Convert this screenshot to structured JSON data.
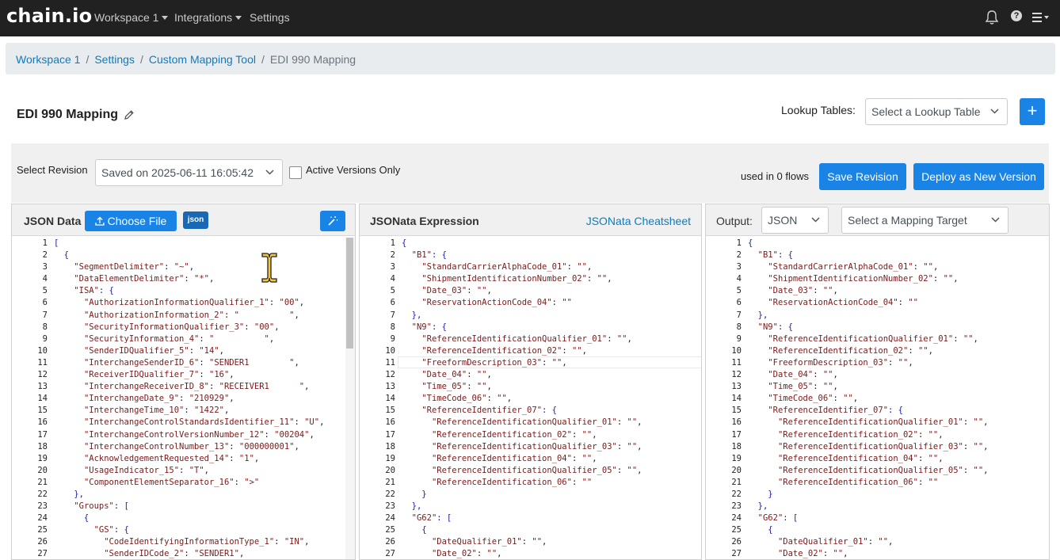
{
  "app": {
    "logo": "chain.io"
  },
  "topnav": {
    "workspace": "Workspace 1",
    "integrations": "Integrations",
    "settings": "Settings"
  },
  "breadcrumb": [
    "Workspace 1",
    "Settings",
    "Custom Mapping Tool",
    "EDI 990 Mapping"
  ],
  "page": {
    "title": "EDI 990 Mapping",
    "lookup_label": "Lookup Tables:",
    "lookup_placeholder": "Select a Lookup Table"
  },
  "revision": {
    "label": "Select Revision",
    "selected": "Saved on 2025-06-11 16:05:42",
    "active_only_label": "Active Versions Only",
    "flows_text": "used in 0 flows",
    "save_button": "Save Revision",
    "deploy_button": "Deploy as New Version"
  },
  "json_panel": {
    "title": "JSON Data",
    "choose_file": "Choose File",
    "badge": "json",
    "lines": [
      "[",
      "  {",
      "    \"SegmentDelimiter\": \"~\",",
      "    \"DataElementDelimiter\": \"*\",",
      "    \"ISA\": {",
      "      \"AuthorizationInformationQualifier_1\": \"00\",",
      "      \"AuthorizationInformation_2\": \"          \",",
      "      \"SecurityInformationQualifier_3\": \"00\",",
      "      \"SecurityInformation_4\": \"          \",",
      "      \"SenderIDQualifier_5\": \"14\",",
      "      \"InterchangeSenderID_6\": \"SENDER1        \",",
      "      \"ReceiverIDQualifier_7\": \"16\",",
      "      \"InterchangeReceiverID_8\": \"RECEIVER1      \",",
      "      \"InterchangeDate_9\": \"210929\",",
      "      \"InterchangeTime_10\": \"1422\",",
      "      \"InterchangeControlStandardsIdentifier_11\": \"U\",",
      "      \"InterchangeControlVersionNumber_12\": \"00204\",",
      "      \"InterchangeControlNumber_13\": \"000000001\",",
      "      \"AcknowledgementRequested_14\": \"1\",",
      "      \"UsageIndicator_15\": \"T\",",
      "      \"ComponentElementSeparator_16\": \">\"",
      "    },",
      "    \"Groups\": [",
      "      {",
      "        \"GS\": {",
      "          \"CodeIdentifyingInformationType_1\": \"IN\",",
      "          \"SenderIDCode_2\": \"SENDER1\","
    ]
  },
  "jsonata_panel": {
    "title": "JSONata Expression",
    "cheatsheet": "JSONata Cheatsheet",
    "lines": [
      "{",
      "  \"B1\": {",
      "    \"StandardCarrierAlphaCode_01\": \"\",",
      "    \"ShipmentIdentificationNumber_02\": \"\",",
      "    \"Date_03\": \"\",",
      "    \"ReservationActionCode_04\": \"\"",
      "  },",
      "  \"N9\": {",
      "    \"ReferenceIdentificationQualifier_01\": \"\",",
      "    \"ReferenceIdentification_02\": \"\",",
      "    \"FreeformDescription_03\": \"\",",
      "    \"Date_04\": \"\",",
      "    \"Time_05\": \"\",",
      "    \"TimeCode_06\": \"\",",
      "    \"ReferenceIdentifier_07\": {",
      "      \"ReferenceIdentificationQualifier_01\": \"\",",
      "      \"ReferenceIdentification_02\": \"\",",
      "      \"ReferenceIdentificationQualifier_03\": \"\",",
      "      \"ReferenceIdentification_04\": \"\",",
      "      \"ReferenceIdentificationQualifier_05\": \"\",",
      "      \"ReferenceIdentification_06\": \"\"",
      "    }",
      "  },",
      "  \"G62\": [",
      "    {",
      "      \"DateQualifier_01\": \"\",",
      "      \"Date_02\": \"\","
    ]
  },
  "output_panel": {
    "title": "Output:",
    "format": "JSON",
    "target_placeholder": "Select a Mapping Target",
    "lines": [
      "{",
      "  \"B1\": {",
      "    \"StandardCarrierAlphaCode_01\": \"\",",
      "    \"ShipmentIdentificationNumber_02\": \"\",",
      "    \"Date_03\": \"\",",
      "    \"ReservationActionCode_04\": \"\"",
      "  },",
      "  \"N9\": {",
      "    \"ReferenceIdentificationQualifier_01\": \"\",",
      "    \"ReferenceIdentification_02\": \"\",",
      "    \"FreeformDescription_03\": \"\",",
      "    \"Date_04\": \"\",",
      "    \"Time_05\": \"\",",
      "    \"TimeCode_06\": \"\",",
      "    \"ReferenceIdentifier_07\": {",
      "      \"ReferenceIdentificationQualifier_01\": \"\",",
      "      \"ReferenceIdentification_02\": \"\",",
      "      \"ReferenceIdentificationQualifier_03\": \"\",",
      "      \"ReferenceIdentification_04\": \"\",",
      "      \"ReferenceIdentificationQualifier_05\": \"\",",
      "      \"ReferenceIdentification_06\": \"\"",
      "    }",
      "  },",
      "  \"G62\": [",
      "    {",
      "      \"DateQualifier_01\": \"\",",
      "      \"Date_02\": \"\","
    ]
  },
  "colors": {
    "topbar": "#212121",
    "primary": "#1a83e6",
    "link": "#0d7bbd",
    "badge": "#1968b5",
    "key": "#7a1a1a",
    "bracket": "#1a1aa6"
  },
  "icons": [
    "bell-icon",
    "help-icon",
    "menu-icon",
    "pencil-icon",
    "upload-icon",
    "magic-wand-icon",
    "chevron-down-icon",
    "plus-icon"
  ]
}
